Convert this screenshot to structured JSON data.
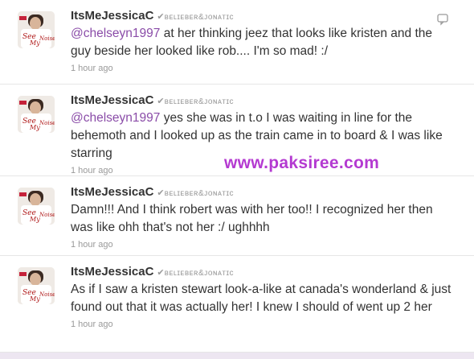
{
  "watermark": "www.paksiree.com",
  "accent_colors": {
    "mention": "#8a4ca8",
    "watermark": "#b43ad1"
  },
  "tweets": [
    {
      "username": "ItsMeJessicaC",
      "verified_mark": "✔",
      "display_name": "ʙᴇʟɪᴇʙᴇʀ&ᴊᴏɴᴀᴛɪᴄ",
      "mention": "@chelseyn1997",
      "text": " at her thinking jeez that looks like kristen and the guy beside her looked like rob.... I'm so mad! :/",
      "timestamp": "1 hour ago",
      "avatar_icon": "profile-photo"
    },
    {
      "username": "ItsMeJessicaC",
      "verified_mark": "✔",
      "display_name": "ʙᴇʟɪᴇʙᴇʀ&ᴊᴏɴᴀᴛɪᴄ",
      "mention": "@chelseyn1997",
      "text": " yes she was in t.o I was waiting in line for the behemoth and I looked up as the train came in to board & I was like starring",
      "timestamp": "1 hour ago",
      "avatar_icon": "profile-photo"
    },
    {
      "username": "ItsMeJessicaC",
      "verified_mark": "✔",
      "display_name": "ʙᴇʟɪᴇʙᴇʀ&ᴊᴏɴᴀᴛɪᴄ",
      "mention": "",
      "text": "Damn!!! And I think robert was with her too!! I recognized her then was like ohh that's not her :/ ughhhh",
      "timestamp": "1 hour ago",
      "avatar_icon": "profile-photo"
    },
    {
      "username": "ItsMeJessicaC",
      "verified_mark": "✔",
      "display_name": "ʙᴇʟɪᴇʙᴇʀ&ᴊᴏɴᴀᴛɪᴄ",
      "mention": "",
      "text": "As if I saw a kristen stewart look-a-like at canada's wonderland & just found out that it was actually her! I knew I should of went up 2 her",
      "timestamp": "1 hour ago",
      "avatar_icon": "profile-photo"
    }
  ],
  "reply_icon": "reply-speech-bubble-icon"
}
